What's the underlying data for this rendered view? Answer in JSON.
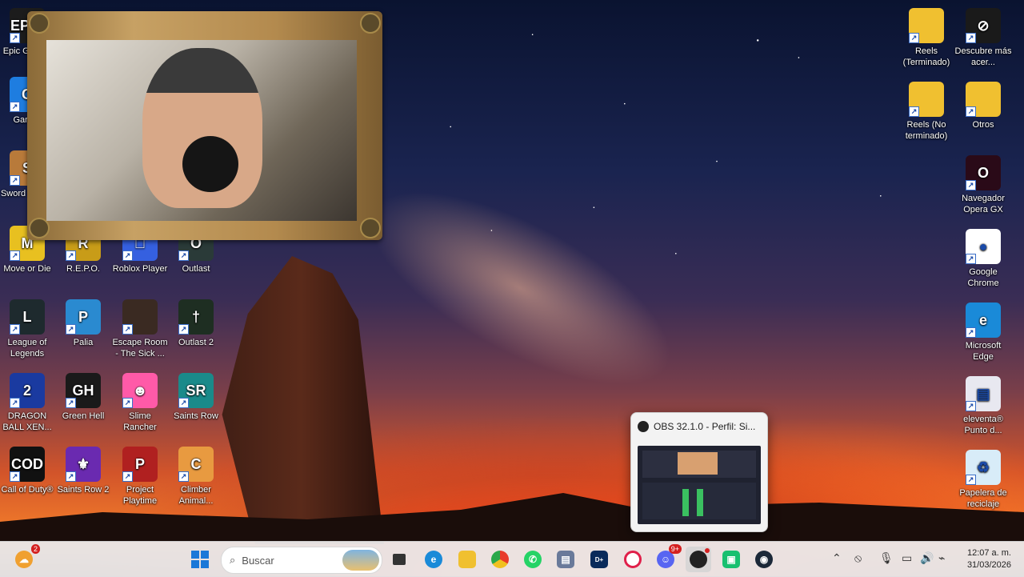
{
  "desktop": {
    "left_icons": [
      {
        "label": "Epic G Laun",
        "color": "#1c1c1c",
        "glyph": "EPIC"
      },
      {
        "label": "Garry's",
        "color": "#1e7de0",
        "glyph": "G"
      },
      {
        "label": "Sword Sanda",
        "color": "#b87a3a",
        "glyph": "S"
      },
      {
        "label": "Move or Die",
        "color": "#e8c020",
        "glyph": "M"
      },
      {
        "label": "R.E.P.O.",
        "color": "#c89c18",
        "glyph": "R"
      },
      {
        "label": "Roblox Player",
        "color": "#3560e0",
        "glyph": "□"
      },
      {
        "label": "Outlast",
        "color": "#2a3a38",
        "glyph": "O"
      },
      {
        "label": "League of Legends",
        "color": "#1e2a2e",
        "glyph": "L"
      },
      {
        "label": "Palia",
        "color": "#2a8ad0",
        "glyph": "P"
      },
      {
        "label": "Escape Room - The Sick ...",
        "color": "#3a2a22",
        "glyph": ""
      },
      {
        "label": "Outlast 2",
        "color": "#1e2e22",
        "glyph": "†"
      },
      {
        "label": "DRAGON BALL XEN...",
        "color": "#1a3aa0",
        "glyph": "2"
      },
      {
        "label": "Green Hell",
        "color": "#1a1a1a",
        "glyph": "GH"
      },
      {
        "label": "Slime Rancher",
        "color": "#ff5aa8",
        "glyph": "☻"
      },
      {
        "label": "Saints Row",
        "color": "#1a8a8a",
        "glyph": "SR"
      },
      {
        "label": "Call of Duty®",
        "color": "#111111",
        "glyph": "COD"
      },
      {
        "label": "Saints Row 2",
        "color": "#6a2ab0",
        "glyph": "⚜"
      },
      {
        "label": "Project Playtime",
        "color": "#b02020",
        "glyph": "P"
      },
      {
        "label": "Climber Animal...",
        "color": "#e89a40",
        "glyph": "C"
      }
    ],
    "right_icons": [
      {
        "label": "Reels (Terminado)",
        "color": "#f0c030",
        "glyph": ""
      },
      {
        "label": "Descubre más acer...",
        "color": "#1a1a1a",
        "glyph": "⊘"
      },
      {
        "label": "Reels (No terminado)",
        "color": "#f0c030",
        "glyph": ""
      },
      {
        "label": "Otros",
        "color": "#f0c030",
        "glyph": ""
      },
      {
        "label": "Navegador Opera GX",
        "color": "#2a0a18",
        "glyph": "O"
      },
      {
        "label": "Google Chrome",
        "color": "#ffffff",
        "glyph": "●"
      },
      {
        "label": "Microsoft Edge",
        "color": "#1a8ad8",
        "glyph": "e"
      },
      {
        "label": "eleventa® Punto d...",
        "color": "#e8e8f0",
        "glyph": "▤"
      },
      {
        "label": "Papelera de reciclaje",
        "color": "#d8ecf8",
        "glyph": "♻"
      }
    ]
  },
  "popup": {
    "title": "OBS 32.1.0 - Perfil: Si..."
  },
  "taskbar": {
    "weather_badge": "2",
    "search_placeholder": "Buscar",
    "discord_badge": "9+",
    "time": "12:07 a. m.",
    "date": "31/03/2026"
  }
}
